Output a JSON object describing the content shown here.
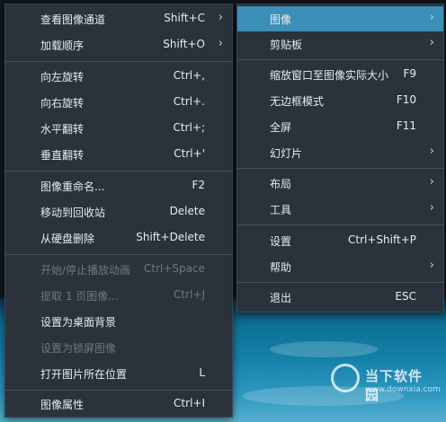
{
  "left_menu": {
    "items": [
      {
        "label": "查看图像通道",
        "shortcut": "Shift+C",
        "arrow": "›",
        "disabled": false
      },
      {
        "label": "加载顺序",
        "shortcut": "Shift+O",
        "arrow": "›",
        "disabled": false
      },
      {
        "label": "向左旋转",
        "shortcut": "Ctrl+,",
        "disabled": false
      },
      {
        "label": "向右旋转",
        "shortcut": "Ctrl+.",
        "disabled": false
      },
      {
        "label": "水平翻转",
        "shortcut": "Ctrl+;",
        "disabled": false
      },
      {
        "label": "垂直翻转",
        "shortcut": "Ctrl+'",
        "disabled": false
      },
      {
        "label": "图像重命名...",
        "shortcut": "F2",
        "disabled": false
      },
      {
        "label": "移动到回收站",
        "shortcut": "Delete",
        "disabled": false
      },
      {
        "label": "从硬盘删除",
        "shortcut": "Shift+Delete",
        "disabled": false
      },
      {
        "label": "开始/停止播放动画",
        "shortcut": "Ctrl+Space",
        "disabled": true
      },
      {
        "label": "提取 1 页图像...",
        "shortcut": "Ctrl+J",
        "disabled": true
      },
      {
        "label": "设置为桌面背景",
        "shortcut": "",
        "disabled": false
      },
      {
        "label": "设置为锁屏图像",
        "shortcut": "",
        "disabled": true
      },
      {
        "label": "打开图片所在位置",
        "shortcut": "L",
        "disabled": false
      },
      {
        "label": "图像属性",
        "shortcut": "Ctrl+I",
        "disabled": false
      }
    ]
  },
  "right_menu": {
    "items": [
      {
        "label": "图像",
        "shortcut": "",
        "arrow": "›",
        "highlighted": true
      },
      {
        "label": "剪贴板",
        "shortcut": "",
        "arrow": "›"
      },
      {
        "label": "缩放窗口至图像实际大小",
        "shortcut": "F9"
      },
      {
        "label": "无边框模式",
        "shortcut": "F10"
      },
      {
        "label": "全屏",
        "shortcut": "F11"
      },
      {
        "label": "幻灯片",
        "shortcut": "",
        "arrow": "›"
      },
      {
        "label": "布局",
        "shortcut": "",
        "arrow": "›"
      },
      {
        "label": "工具",
        "shortcut": "",
        "arrow": "›"
      },
      {
        "label": "设置",
        "shortcut": "Ctrl+Shift+P"
      },
      {
        "label": "帮助",
        "shortcut": "",
        "arrow": "›"
      },
      {
        "label": "退出",
        "shortcut": "ESC"
      }
    ]
  },
  "watermark": {
    "title": "当下软件园",
    "url": "www.downxia.com"
  },
  "colors": {
    "menu_bg": "#2a323c",
    "highlight": "#3c8fb7",
    "disabled_text": "#6f7780"
  }
}
